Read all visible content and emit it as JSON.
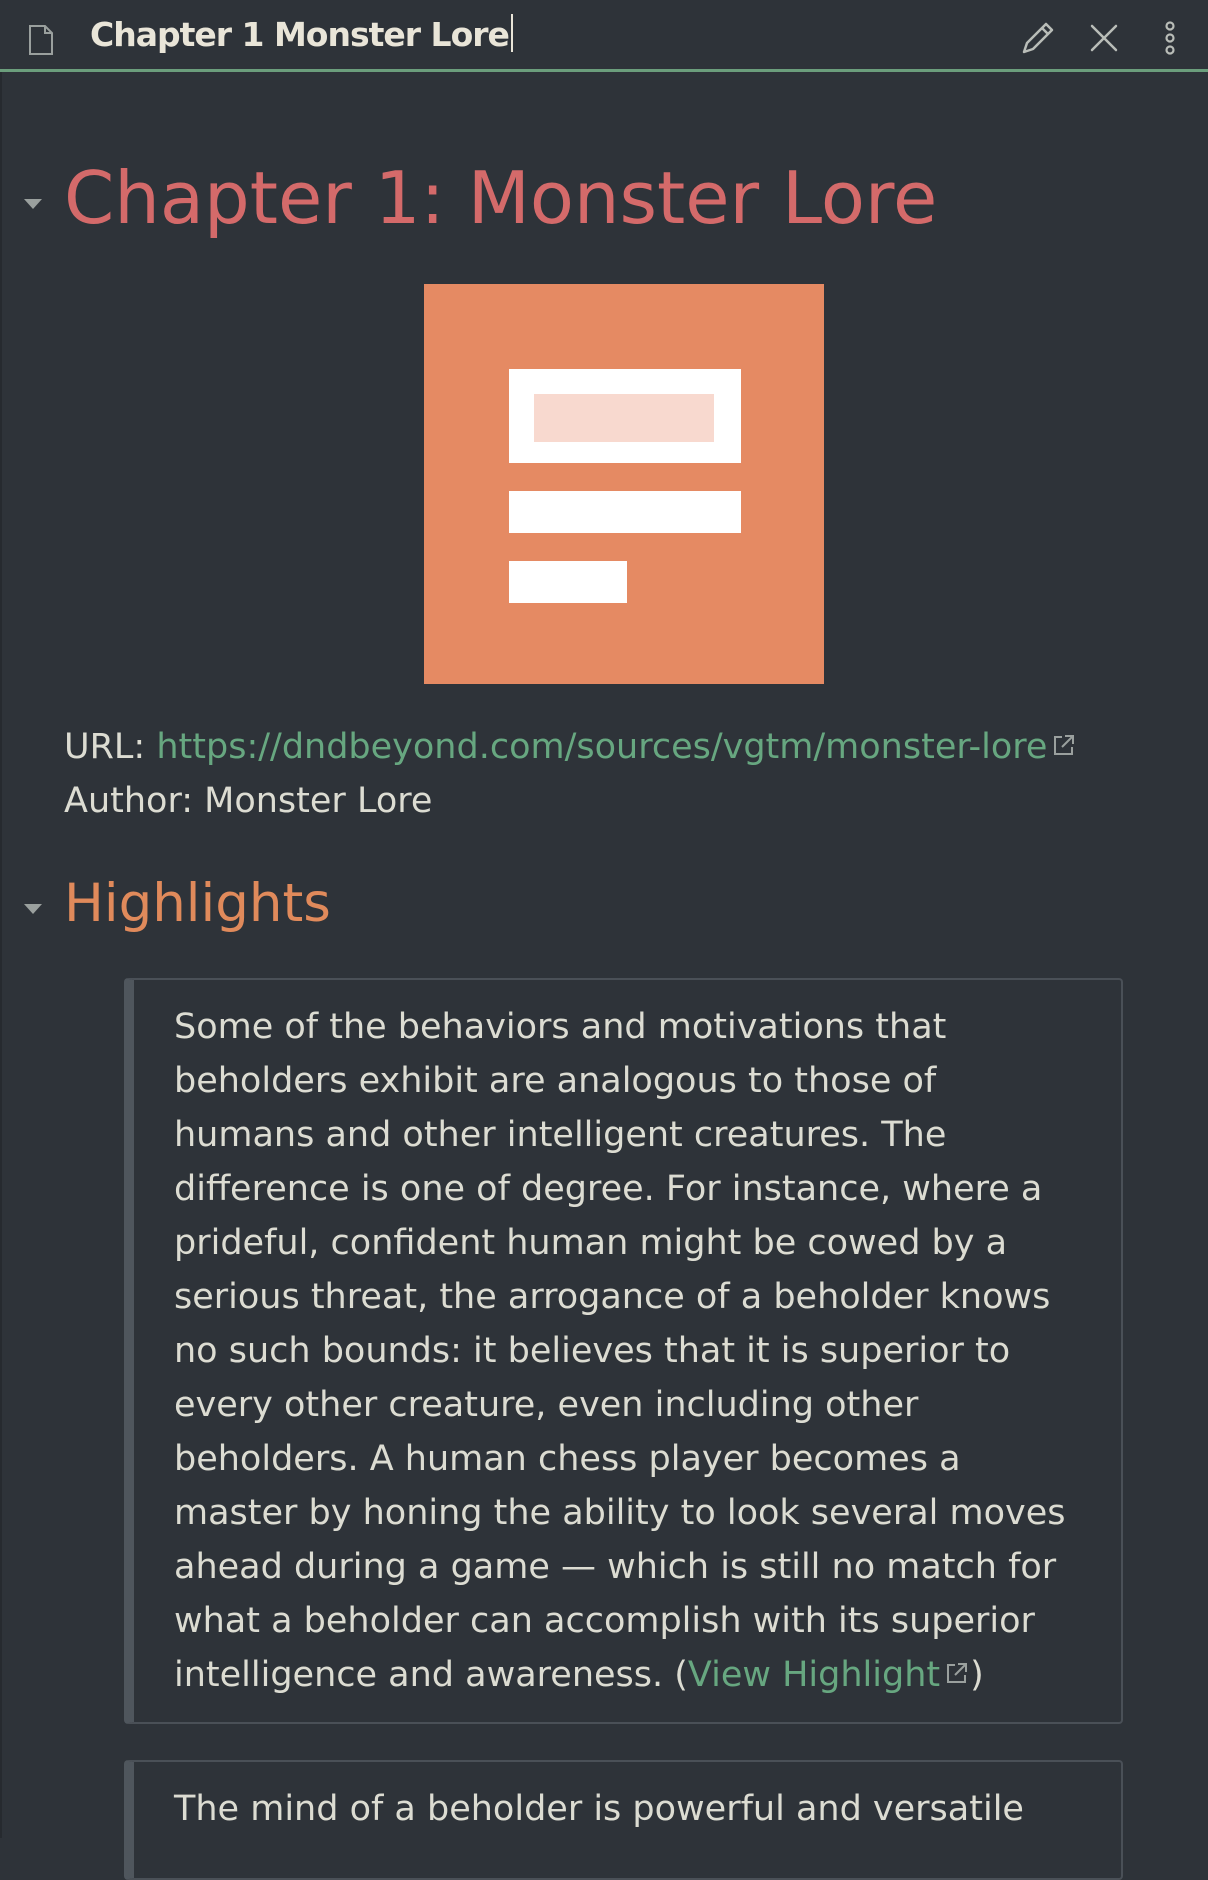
{
  "header": {
    "title": "Chapter 1 Monster Lore",
    "icons": [
      "document-icon",
      "edit-icon",
      "close-icon",
      "more-options-icon"
    ]
  },
  "note": {
    "heading": "Chapter 1: Monster Lore",
    "cover_image": "article-placeholder-icon",
    "url_label": "URL: ",
    "url": "https://dndbeyond.com/sources/vgtm/monster-lore",
    "author_label": "Author: ",
    "author": "Monster Lore",
    "highlights_heading": "Highlights",
    "highlights": [
      {
        "text": "Some of the behaviors and motivations that beholders exhibit are analogous to those of humans and other intelligent creatures. The difference is one of degree. For instance, where a prideful, confident human might be cowed by a serious threat, the arrogance of a beholder knows no such bounds: it believes that it is superior to every other creature, even including other beholders. A human chess player becomes a master by honing the ability to look several moves ahead during a game — which is still no match for what a beholder can accomplish with its superior intelligence and awareness. (",
        "link_label": "View Highlight",
        "suffix": ")"
      },
      {
        "text": "The mind of a beholder is powerful and versatile"
      }
    ]
  },
  "colors": {
    "background": "#2e3339",
    "h1": "#d46a6a",
    "h2": "#e08a5b",
    "link": "#67a780",
    "accent_border": "#6b9e7c",
    "cover": "#e58a63"
  }
}
